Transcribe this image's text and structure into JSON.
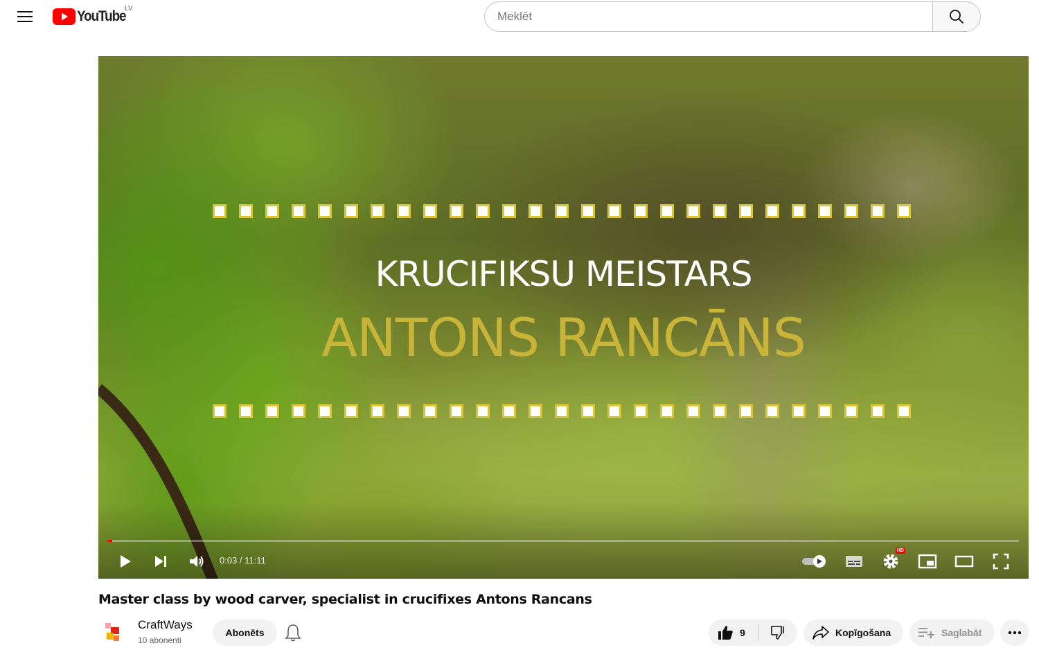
{
  "header": {
    "logo_text": "YouTube",
    "region": "LV",
    "search_placeholder": "Meklēt"
  },
  "player": {
    "overlay_line1": "KRUCIFIKSU MEISTARS",
    "overlay_line2": "ANTONS RANCĀNS",
    "time_display": "0:03 / 11:11",
    "progress_fraction": 0.0045,
    "hd_badge": "HD",
    "accent_color": "#ff0000"
  },
  "video": {
    "title": "Master class by wood carver, specialist in crucifixes Antons Rancans"
  },
  "channel": {
    "name": "CraftWays",
    "subscribers": "10 abonenti",
    "subscribed_label": "Abonēts"
  },
  "actions": {
    "like_count": "9",
    "share_label": "Kopīgošana",
    "save_label": "Saglabāt"
  }
}
